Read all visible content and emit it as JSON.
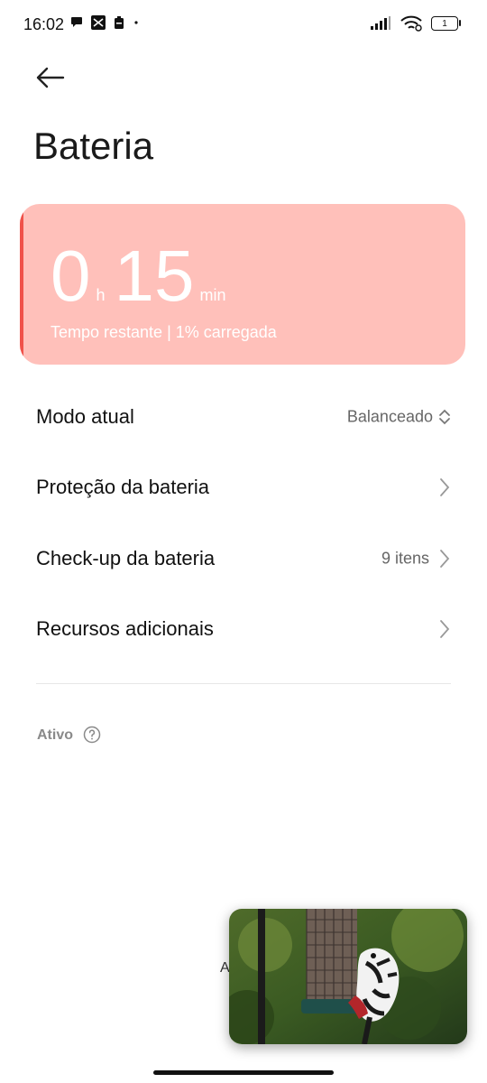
{
  "status_bar": {
    "time": "16:02",
    "battery_level": "1"
  },
  "header": {
    "title": "Bateria"
  },
  "battery_card": {
    "hours": "0",
    "hours_unit": "h",
    "minutes": "15",
    "minutes_unit": "min",
    "subtitle": "Tempo restante | 1% carregada",
    "colors": {
      "background": "#ffc0ba",
      "accent": "#f0524a"
    }
  },
  "settings": {
    "items": [
      {
        "label": "Modo atual",
        "value": "Balanceado",
        "icon": "updown-chevron-icon"
      },
      {
        "label": "Proteção da bateria",
        "value": "",
        "icon": "chevron-right-icon"
      },
      {
        "label": "Check-up da bateria",
        "value": "9 itens",
        "icon": "chevron-right-icon"
      },
      {
        "label": "Recursos adicionais",
        "value": "",
        "icon": "chevron-right-icon"
      }
    ]
  },
  "section": {
    "active_label": "Ativo"
  },
  "overlay": {
    "partial_text": "A"
  }
}
